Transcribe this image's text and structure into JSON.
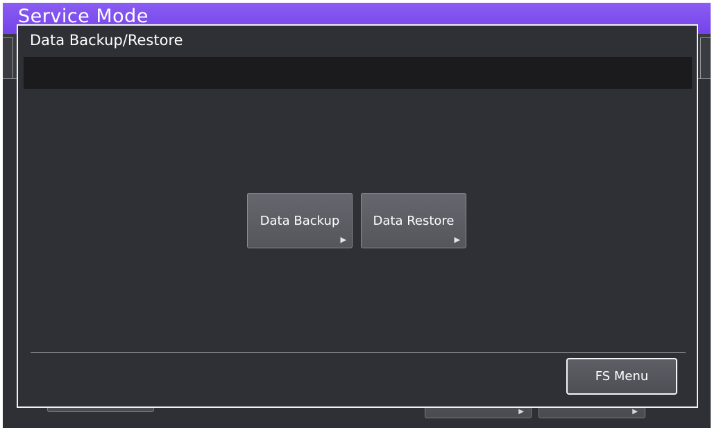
{
  "background_screen": {
    "title": "Service Mode",
    "header_color": "#7a4bee"
  },
  "dialog": {
    "title": "Data Backup/Restore",
    "message": "",
    "buttons": [
      {
        "label": "Data Backup",
        "arrow": "▶"
      },
      {
        "label": "Data Restore",
        "arrow": "▶"
      }
    ],
    "footer_button": "FS Menu"
  },
  "colors": {
    "accent": "#7a4bee",
    "panel": "#2f3035",
    "message_bar": "#1b1b1d",
    "button": "#5f6168"
  }
}
